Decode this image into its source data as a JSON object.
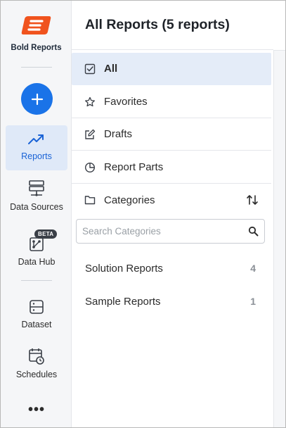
{
  "brand": {
    "name": "Bold Reports",
    "color": "#f0531e"
  },
  "rail": {
    "accent": "#1a73e8",
    "items": [
      {
        "label": "Reports",
        "icon": "trending-up-icon",
        "active": true
      },
      {
        "label": "Data Sources",
        "icon": "server-icon",
        "active": false
      },
      {
        "label": "Data Hub",
        "icon": "data-hub-icon",
        "badge": "BETA",
        "active": false
      },
      {
        "label": "Dataset",
        "icon": "dataset-icon",
        "active": false
      },
      {
        "label": "Schedules",
        "icon": "calendar-clock-icon",
        "active": false
      }
    ],
    "more": "•••"
  },
  "header": {
    "title": "All Reports (5 reports)"
  },
  "nav": {
    "items": [
      {
        "label": "All",
        "icon": "checkbox-icon",
        "active": true
      },
      {
        "label": "Favorites",
        "icon": "star-icon",
        "active": false
      },
      {
        "label": "Drafts",
        "icon": "edit-icon",
        "active": false
      },
      {
        "label": "Report Parts",
        "icon": "pie-chart-icon",
        "active": false
      },
      {
        "label": "Categories",
        "icon": "folder-icon",
        "active": false
      }
    ]
  },
  "search": {
    "placeholder": "Search Categories",
    "value": ""
  },
  "categories": [
    {
      "name": "Solution Reports",
      "count": "4"
    },
    {
      "name": "Sample Reports",
      "count": "1"
    }
  ]
}
